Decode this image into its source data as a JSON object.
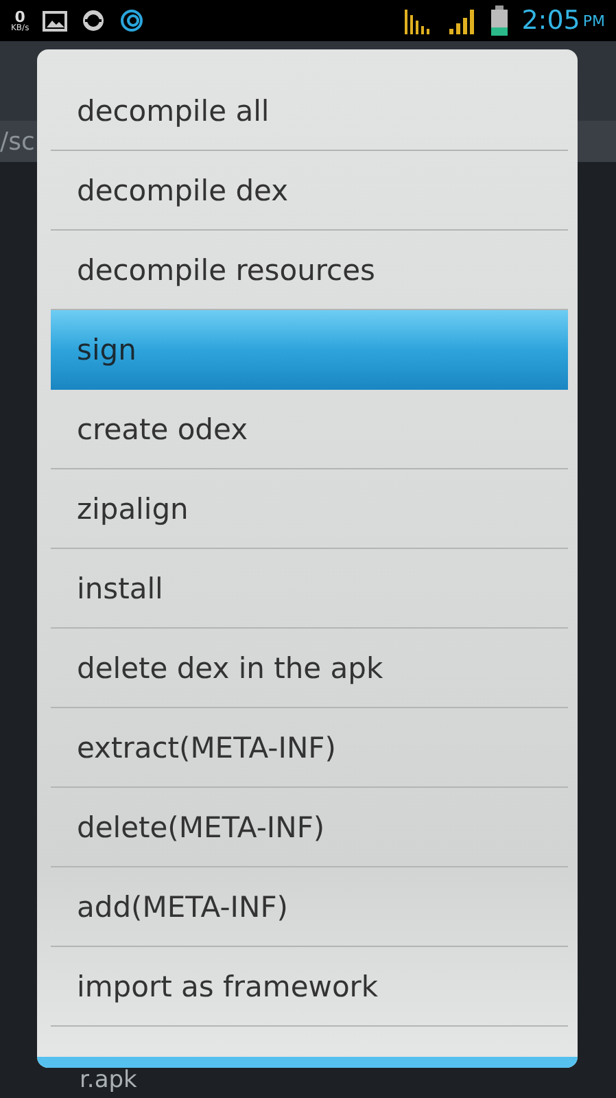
{
  "status_bar": {
    "speed_value": "0",
    "speed_unit": "KB/s",
    "time": "2:05",
    "meridiem": "PM"
  },
  "background": {
    "path_fragment": "/sc",
    "file_fragment": "r.apk"
  },
  "menu": {
    "items": [
      {
        "label": "decompile all",
        "selected": false
      },
      {
        "label": "decompile dex",
        "selected": false
      },
      {
        "label": "decompile resources",
        "selected": false
      },
      {
        "label": "sign",
        "selected": true
      },
      {
        "label": "create odex",
        "selected": false
      },
      {
        "label": "zipalign",
        "selected": false
      },
      {
        "label": "install",
        "selected": false
      },
      {
        "label": "delete dex in the apk",
        "selected": false
      },
      {
        "label": "extract(META-INF)",
        "selected": false
      },
      {
        "label": "delete(META-INF)",
        "selected": false
      },
      {
        "label": "add(META-INF)",
        "selected": false
      },
      {
        "label": "import as framework",
        "selected": false
      }
    ]
  }
}
